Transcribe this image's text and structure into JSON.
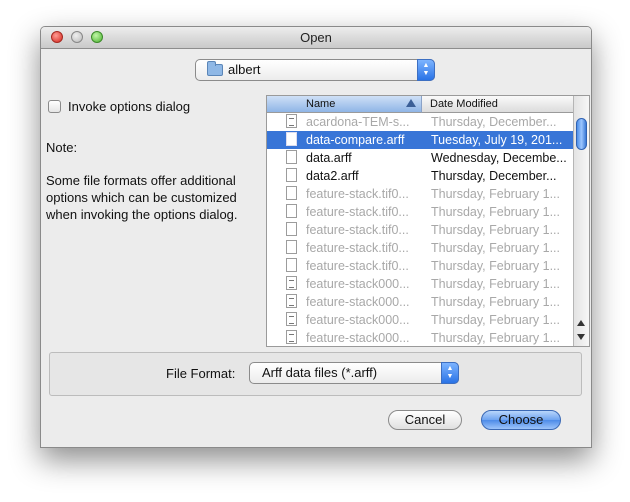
{
  "window": {
    "title": "Open"
  },
  "location": {
    "folder": "albert"
  },
  "options": {
    "invoke_label": "Invoke options dialog",
    "invoke_checked": false
  },
  "note": {
    "title": "Note:",
    "body": "Some file formats offer additional options which can be customized when invoking the options dialog."
  },
  "file_list": {
    "columns": {
      "name": "Name",
      "date": "Date Modified"
    },
    "sorted_by": "Name",
    "rows": [
      {
        "name": "acardona-TEM-s...",
        "date": "Thursday, December...",
        "state": "disabled",
        "icon": "document-icon"
      },
      {
        "name": "data-compare.arff",
        "date": "Tuesday, July 19, 201...",
        "state": "selected",
        "icon": "file-icon"
      },
      {
        "name": "data.arff",
        "date": "Wednesday, Decembe...",
        "state": "enabled",
        "icon": "file-icon"
      },
      {
        "name": "data2.arff",
        "date": "Thursday, December...",
        "state": "enabled",
        "icon": "file-icon"
      },
      {
        "name": "feature-stack.tif0...",
        "date": "Thursday, February 1...",
        "state": "disabled",
        "icon": "file-icon"
      },
      {
        "name": "feature-stack.tif0...",
        "date": "Thursday, February 1...",
        "state": "disabled",
        "icon": "file-icon"
      },
      {
        "name": "feature-stack.tif0...",
        "date": "Thursday, February 1...",
        "state": "disabled",
        "icon": "file-icon"
      },
      {
        "name": "feature-stack.tif0...",
        "date": "Thursday, February 1...",
        "state": "disabled",
        "icon": "file-icon"
      },
      {
        "name": "feature-stack.tif0...",
        "date": "Thursday, February 1...",
        "state": "disabled",
        "icon": "file-icon"
      },
      {
        "name": "feature-stack000...",
        "date": "Thursday, February 1...",
        "state": "disabled",
        "icon": "document-icon"
      },
      {
        "name": "feature-stack000...",
        "date": "Thursday, February 1...",
        "state": "disabled",
        "icon": "document-icon"
      },
      {
        "name": "feature-stack000...",
        "date": "Thursday, February 1...",
        "state": "disabled",
        "icon": "document-icon"
      },
      {
        "name": "feature-stack000...",
        "date": "Thursday, February 1...",
        "state": "disabled",
        "icon": "document-icon"
      }
    ]
  },
  "format": {
    "label": "File Format:",
    "value": "Arff data files (*.arff)"
  },
  "buttons": {
    "cancel": "Cancel",
    "choose": "Choose"
  },
  "colors": {
    "selection": "#3875d7",
    "disabled_text": "#a8a8a8",
    "default_button": "#6ea3f0"
  }
}
